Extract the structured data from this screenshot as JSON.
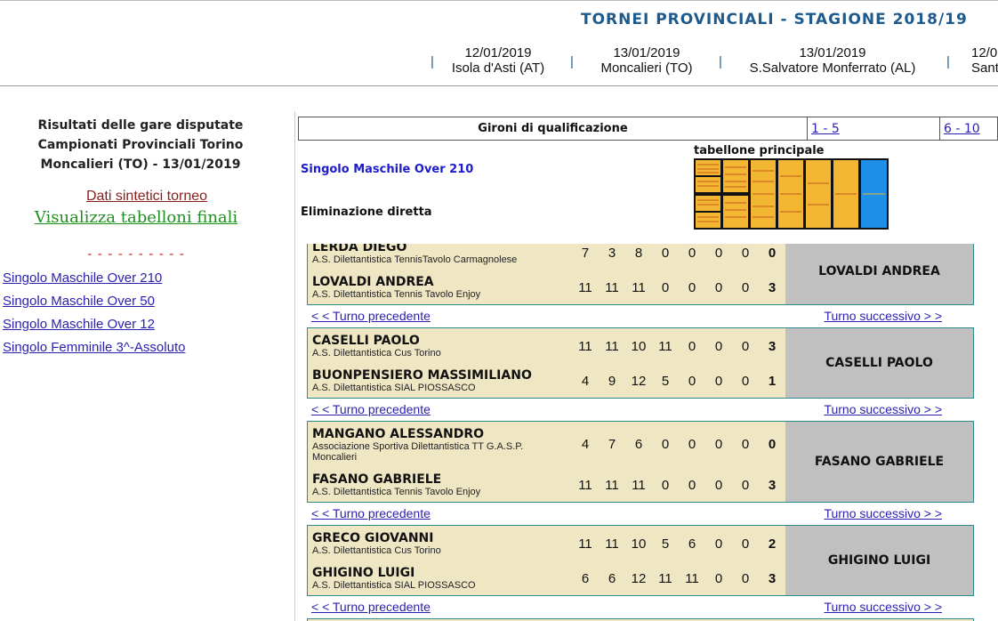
{
  "header": {
    "title": "TORNEI PROVINCIALI - STAGIONE  2018/19",
    "events": [
      {
        "date": "12/01/2019",
        "place": "Isola d'Asti (AT)"
      },
      {
        "date": "13/01/2019",
        "place": "Moncalieri (TO)"
      },
      {
        "date": "13/01/2019",
        "place": "S.Salvatore Monferrato (AL)"
      },
      {
        "date": "12/0",
        "place": "Sant"
      }
    ]
  },
  "sidebar": {
    "title_lines": [
      "Risultati delle gare disputate",
      "Campionati Provinciali Torino",
      "Moncalieri (TO) - 13/01/2019"
    ],
    "dati_link": "Dati sintetici torneo",
    "tabelloni_link": "Visualizza tabelloni finali",
    "dashes": "- - - - - - - - - -",
    "categories": [
      "Singolo Maschile Over 210",
      "Singolo Maschile Over 50",
      "Singolo Maschile Over 12",
      "Singolo Femminile 3^-Assoluto"
    ]
  },
  "gironi": {
    "label": "Gironi di qualificazione",
    "link1": "1 - 5",
    "link2": "6 - 10"
  },
  "main": {
    "category": "Singolo Maschile Over 210",
    "elimination": "Eliminazione diretta",
    "bracket_label": "tabellone principale",
    "prev_label": "< < Turno precedente",
    "next_label": "Turno successivo > >"
  },
  "matches": [
    {
      "p1": {
        "name": "LERDA DIEGO",
        "club": "A.S. Dilettantistica TennisTavolo Carmagnolese",
        "scores": [
          "7",
          "3",
          "8",
          "0",
          "0",
          "0",
          "0"
        ],
        "total": "0"
      },
      "p2": {
        "name": "LOVALDI ANDREA",
        "club": "A.S. Dilettantistica Tennis Tavolo Enjoy",
        "scores": [
          "11",
          "11",
          "11",
          "0",
          "0",
          "0",
          "0"
        ],
        "total": "3"
      },
      "winner": "LOVALDI ANDREA"
    },
    {
      "p1": {
        "name": "CASELLI PAOLO",
        "club": "A.S. Dilettantistica Cus Torino",
        "scores": [
          "11",
          "11",
          "10",
          "11",
          "0",
          "0",
          "0"
        ],
        "total": "3"
      },
      "p2": {
        "name": "BUONPENSIERO MASSIMILIANO",
        "club": "A.S. Dilettantistica SIAL PIOSSASCO",
        "scores": [
          "4",
          "9",
          "12",
          "5",
          "0",
          "0",
          "0"
        ],
        "total": "1"
      },
      "winner": "CASELLI PAOLO"
    },
    {
      "p1": {
        "name": "MANGANO ALESSANDRO",
        "club": "Associazione Sportiva Dilettantistica TT G.A.S.P. Moncalieri",
        "scores": [
          "4",
          "7",
          "6",
          "0",
          "0",
          "0",
          "0"
        ],
        "total": "0"
      },
      "p2": {
        "name": "FASANO GABRIELE",
        "club": "A.S. Dilettantistica Tennis Tavolo Enjoy",
        "scores": [
          "11",
          "11",
          "11",
          "0",
          "0",
          "0",
          "0"
        ],
        "total": "3"
      },
      "winner": "FASANO GABRIELE"
    },
    {
      "p1": {
        "name": "GRECO GIOVANNI",
        "club": "A.S. Dilettantistica Cus Torino",
        "scores": [
          "11",
          "11",
          "10",
          "5",
          "6",
          "0",
          "0"
        ],
        "total": "2"
      },
      "p2": {
        "name": "GHIGINO LUIGI",
        "club": "A.S. Dilettantistica SIAL PIOSSASCO",
        "scores": [
          "6",
          "6",
          "12",
          "11",
          "11",
          "0",
          "0"
        ],
        "total": "3"
      },
      "winner": "GHIGINO LUIGI"
    }
  ]
}
